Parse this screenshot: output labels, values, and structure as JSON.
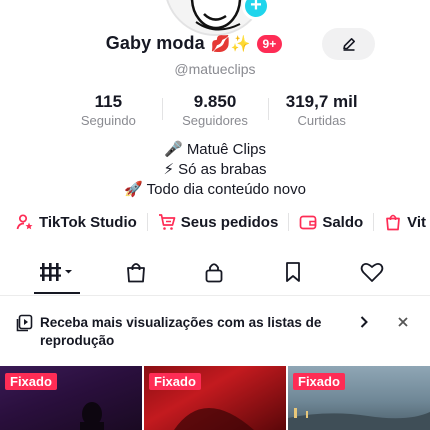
{
  "profile": {
    "display_name": "Gaby moda",
    "name_emoji": "💋✨",
    "notification_count": "9+",
    "username": "@matueclips"
  },
  "stats": [
    {
      "value": "115",
      "label": "Seguindo"
    },
    {
      "value": "9.850",
      "label": "Seguidores"
    },
    {
      "value": "319,7 mil",
      "label": "Curtidas"
    }
  ],
  "bio": [
    "🎤 Matuê Clips",
    "⚡ Só as brabas",
    "🚀 Todo dia conteúdo novo"
  ],
  "quick_links": [
    {
      "label": "TikTok Studio",
      "icon": "person-star-icon"
    },
    {
      "label": "Seus pedidos",
      "icon": "cart-icon"
    },
    {
      "label": "Saldo",
      "icon": "wallet-icon"
    },
    {
      "label": "Vit",
      "icon": "shopping-bag-icon"
    }
  ],
  "tabs": [
    {
      "name": "videos-grid",
      "icon": "grid-icon",
      "active": true
    },
    {
      "name": "shop",
      "icon": "shopping-bag-icon"
    },
    {
      "name": "private",
      "icon": "lock-icon"
    },
    {
      "name": "favorites",
      "icon": "bookmark-icon"
    },
    {
      "name": "liked",
      "icon": "heart-icon"
    }
  ],
  "promo_banner": {
    "text": "Receba mais visualizações com as listas de reprodução",
    "icon": "playlist-icon"
  },
  "videos": [
    {
      "badge": "Fixado"
    },
    {
      "badge": "Fixado"
    },
    {
      "badge": "Fixado"
    }
  ],
  "colors": {
    "accent": "#fe2c55",
    "verified_plus": "#20d5ec",
    "text": "#161823",
    "muted": "#8a8b91"
  }
}
